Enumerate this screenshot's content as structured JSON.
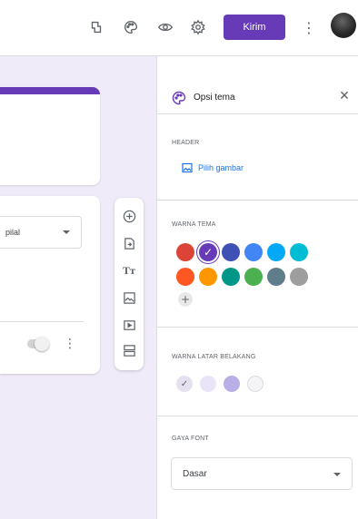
{
  "toolbar": {
    "icons": [
      "customize-theme-icon",
      "palette-icon",
      "preview-icon",
      "settings-icon"
    ],
    "send_label": "Kirim",
    "more_icon": "more-vert-icon"
  },
  "question": {
    "type_value": "pilal",
    "more_icon": "more-vert-icon"
  },
  "floating_toolbar": {
    "items": [
      "add-question-icon",
      "import-questions-icon",
      "add-title-icon",
      "add-image-icon",
      "add-video-icon",
      "add-section-icon"
    ],
    "title_glyph": "Tт"
  },
  "theme_panel": {
    "title": "Opsi tema",
    "header_label": "HEADER",
    "choose_image_label": "Pilih gambar",
    "theme_color_label": "WARNA TEMA",
    "theme_colors": [
      "#db4437",
      "#673ab7",
      "#3f51b5",
      "#4285f4",
      "#03a9f4",
      "#00bcd4",
      "#ff5722",
      "#ff9800",
      "#009688",
      "#4caf50",
      "#607d8b",
      "#9e9e9e"
    ],
    "selected_theme_color": "#673ab7",
    "bg_color_label": "WARNA LATAR BELAKANG",
    "bg_colors": [
      "#e6e1f0",
      "#e9e4f7",
      "#b9aee6",
      "#f4f4f6"
    ],
    "selected_bg_color": "#e6e1f0",
    "font_label": "GAYA FONT",
    "font_value": "Dasar"
  },
  "colors": {
    "accent": "#673ab7",
    "link": "#1a73e8",
    "canvas_bg": "#f0ebf8"
  }
}
